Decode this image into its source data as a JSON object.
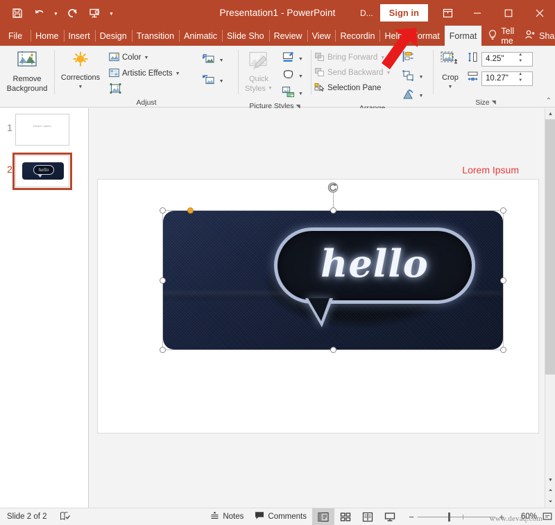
{
  "window": {
    "title": "Presentation1  -  PowerPoint",
    "account_label": "D...",
    "signin_label": "Sign in",
    "ribbon_display_icon": "ribbon-display-options-icon",
    "minimize_icon": "minimize-icon",
    "maximize_icon": "maximize-icon",
    "close_icon": "close-icon"
  },
  "quick_access": [
    {
      "name": "save",
      "icon": "save-icon"
    },
    {
      "name": "undo",
      "icon": "undo-icon"
    },
    {
      "name": "redo",
      "icon": "redo-icon"
    },
    {
      "name": "start-from-beginning",
      "icon": "slideshow-icon"
    },
    {
      "name": "customize",
      "icon": "chevron-down-icon"
    }
  ],
  "tabs": [
    {
      "label": "File",
      "active": false
    },
    {
      "label": "Home",
      "active": false
    },
    {
      "label": "Insert",
      "active": false
    },
    {
      "label": "Design",
      "active": false
    },
    {
      "label": "Transition",
      "active": false
    },
    {
      "label": "Animatic",
      "active": false
    },
    {
      "label": "Slide Sho",
      "active": false
    },
    {
      "label": "Review",
      "active": false
    },
    {
      "label": "View",
      "active": false
    },
    {
      "label": "Recordin",
      "active": false
    },
    {
      "label": "Help",
      "active": false
    },
    {
      "label": "Format",
      "active": false
    },
    {
      "label": "Format",
      "active": true
    }
  ],
  "tabs_right": {
    "tell_me": "Tell me",
    "tell_me_icon": "lightbulb-icon",
    "share": "Share",
    "share_icon": "share-person-icon"
  },
  "ribbon": {
    "groups": [
      {
        "label": "",
        "buttons": [
          {
            "label": "Remove\nBackground",
            "line1": "Remove",
            "line2": "Background",
            "icon": "remove-background-icon"
          }
        ]
      },
      {
        "label": "Adjust",
        "corrections_label": "Corrections",
        "color_label": "Color",
        "artistic_effects_label": "Artistic Effects",
        "transparency_icon": "transparency-icon",
        "compress_icon": "compress-pictures-icon",
        "change_icon": "change-picture-icon",
        "reset_icon": "reset-picture-icon"
      },
      {
        "label": "Picture Styles",
        "quick_styles_line1": "Quick",
        "quick_styles_line2": "Styles",
        "quick_styles_disabled": true,
        "picture_border_icon": "picture-border-icon",
        "picture_effects_icon": "picture-effects-icon",
        "picture_layout_icon": "picture-layout-icon",
        "dialog_launcher": "dialog-launcher-icon"
      },
      {
        "label": "Arrange",
        "bring_forward": "Bring Forward",
        "bring_forward_disabled": true,
        "send_backward": "Send Backward",
        "send_backward_disabled": true,
        "selection_pane": "Selection Pane",
        "align_icon": "align-objects-icon",
        "group_icon": "group-objects-icon",
        "rotate_icon": "rotate-objects-icon"
      },
      {
        "label": "Size",
        "crop_label": "Crop",
        "crop_icon": "crop-icon",
        "height_icon": "shape-height-icon",
        "height_value": "4.25\"",
        "width_icon": "shape-width-icon",
        "width_value": "10.27\"",
        "dialog_launcher": "dialog-launcher-icon"
      }
    ],
    "collapse_icon": "collapse-ribbon-icon"
  },
  "thumbnails": [
    {
      "number": "1",
      "selected": false,
      "title": "Sample Caption"
    },
    {
      "number": "2",
      "selected": true,
      "title": ""
    }
  ],
  "slide": {
    "title": "Lorem Ipsum",
    "title_color": "#e8393a",
    "picture_alt": "hello neon sign speech bubble",
    "picture_text": "hello",
    "selected": true,
    "rotate_handle_icon": "rotate-handle-icon"
  },
  "status": {
    "slide_counter": "Slide 2 of 2",
    "accessibility_icon": "accessibility-check-icon",
    "notes_label": "Notes",
    "notes_icon": "notes-icon",
    "comments_label": "Comments",
    "comments_icon": "comment-icon",
    "views": [
      {
        "name": "normal-view",
        "icon": "normal-view-icon",
        "active": true
      },
      {
        "name": "slide-sorter-view",
        "icon": "slide-sorter-icon",
        "active": false
      },
      {
        "name": "reading-view",
        "icon": "reading-view-icon",
        "active": false
      },
      {
        "name": "slide-show-view",
        "icon": "slide-show-icon",
        "active": false
      }
    ],
    "zoom_out_label": "−",
    "zoom_in_label": "+",
    "zoom_value": "60%",
    "fit_slide_icon": "fit-to-window-icon",
    "watermark": "www.devaq.com"
  },
  "colors": {
    "accent": "#b7472a",
    "ribbon_bg": "#f3f3f3",
    "canvas_bg": "#f3f3f3",
    "title_red": "#e8393a",
    "selection_orange": "#eda12b",
    "arrow_red": "#e81b1b"
  }
}
